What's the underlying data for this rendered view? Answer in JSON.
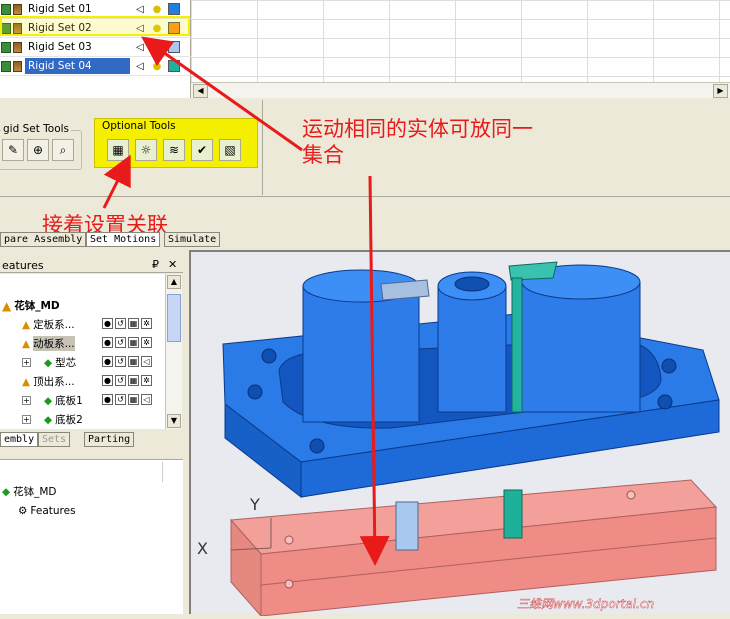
{
  "rigid_sets": [
    {
      "label": "Rigid Set 01",
      "color": "#1e7fe0",
      "selected": false
    },
    {
      "label": "Rigid Set 02",
      "color": "#ff8c1a",
      "selected": false
    },
    {
      "label": "Rigid Set 03",
      "color": "#a8c8f0",
      "selected": false
    },
    {
      "label": "Rigid Set 04",
      "color": "#20b0a0",
      "selected": true
    }
  ],
  "toolbar": {
    "rigid_set_tools_label": "gid Set Tools",
    "optional_tools_label": "Optional Tools"
  },
  "annotations": {
    "same_motion_line1": "运动相同的实体可放同一",
    "same_motion_line2": "集合",
    "join_settings": "接着设置关联"
  },
  "tabs": {
    "prepare_assembly": "pare Assembly",
    "set_motions": "Set Motions",
    "simulate": "Simulate"
  },
  "features_panel": {
    "title": "eatures",
    "pin": "₽",
    "close": "✕",
    "root": "花钵_MD",
    "items": [
      {
        "label": "定板系...",
        "level": 1,
        "selected": false
      },
      {
        "label": "动板系...",
        "level": 1,
        "selected": true
      },
      {
        "label": "型芯",
        "level": 2,
        "selected": false
      },
      {
        "label": "顶出系...",
        "level": 1,
        "selected": false
      },
      {
        "label": "底板1",
        "level": 2,
        "selected": false
      },
      {
        "label": "底板2",
        "level": 2,
        "selected": false
      }
    ],
    "tabs": [
      "embly",
      "Sets",
      "Parting"
    ]
  },
  "lower_tree": {
    "root": "花钵_MD",
    "child": "Features"
  },
  "viewport": {
    "axis_y": "Y",
    "axis_x": "X",
    "watermark": "三维网www.3dportal.cn"
  },
  "colors": {
    "annotation_red": "#e81a1a",
    "highlight_yellow": "#f5f000",
    "selection_blue": "#316ac5",
    "part_blue": "#1e6fe8",
    "plate_pink": "#f0908a"
  }
}
